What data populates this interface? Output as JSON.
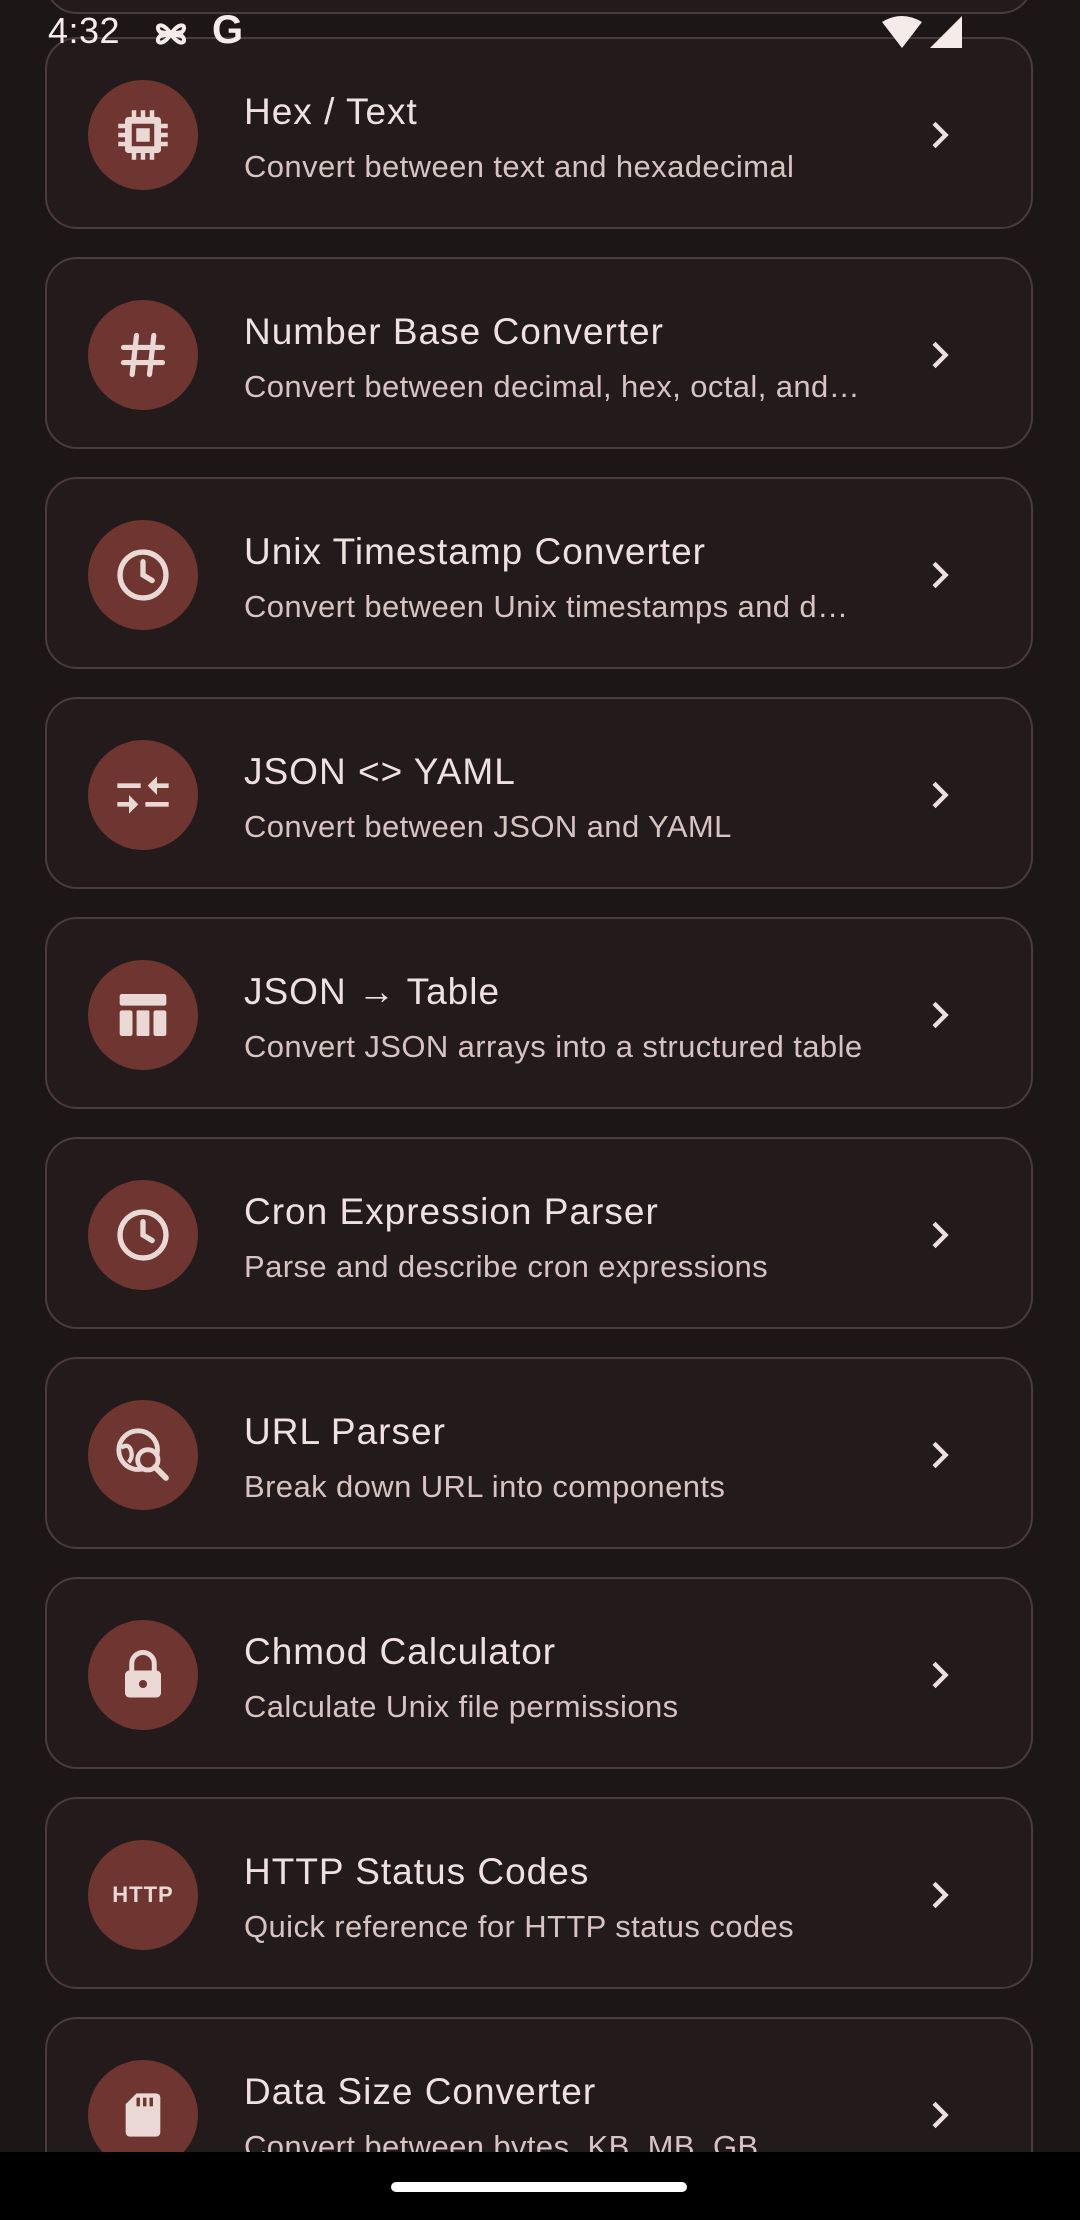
{
  "status_bar": {
    "time": "4:32",
    "icons": [
      "pinwheel-icon",
      "google-icon",
      "wifi-icon",
      "signal-icon"
    ],
    "google_letter": "G"
  },
  "tools": [
    {
      "title": "Hex / Text",
      "subtitle": "Convert between text and hexadecimal",
      "icon": "memory-chip-icon"
    },
    {
      "title": "Number Base Converter",
      "subtitle": "Convert between decimal, hex, octal, and binary",
      "icon": "hash-icon"
    },
    {
      "title": "Unix Timestamp Converter",
      "subtitle": "Convert between Unix timestamps and dates",
      "icon": "clock-icon"
    },
    {
      "title": "JSON <> YAML",
      "subtitle": "Convert between JSON and YAML",
      "icon": "swap-arrows-icon"
    },
    {
      "title": "JSON → Table",
      "subtitle": "Convert JSON arrays into a structured table",
      "icon": "table-icon"
    },
    {
      "title": "Cron Expression Parser",
      "subtitle": "Parse and describe cron expressions",
      "icon": "clock-icon"
    },
    {
      "title": "URL Parser",
      "subtitle": "Break down URL into components",
      "icon": "globe-search-icon"
    },
    {
      "title": "Chmod Calculator",
      "subtitle": "Calculate Unix file permissions",
      "icon": "lock-icon"
    },
    {
      "title": "HTTP Status Codes",
      "subtitle": "Quick reference for HTTP status codes",
      "icon": "http-icon"
    },
    {
      "title": "Data Size Converter",
      "subtitle": "Convert between bytes, KB, MB, GB",
      "icon": "sd-card-icon"
    }
  ],
  "http_badge_text": "HTTP",
  "colors": {
    "background": "#1d1617",
    "card": "#221a1b",
    "card_border": "#4a3c3c",
    "icon_circle": "#6f3530",
    "title_text": "#efe1df",
    "subtitle_text": "#d7c3c1"
  }
}
